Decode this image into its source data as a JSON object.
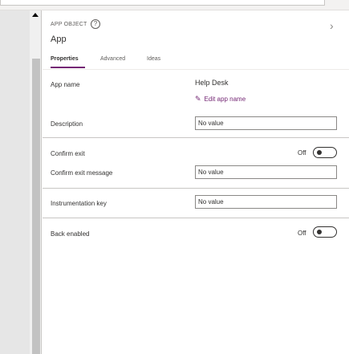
{
  "panel": {
    "object_type": "APP OBJECT",
    "object_name": "App",
    "info_icon": "?",
    "chevron_icon": "›"
  },
  "tabs": [
    {
      "label": "Properties",
      "active": true
    },
    {
      "label": "Advanced",
      "active": false
    },
    {
      "label": "Ideas",
      "active": false
    }
  ],
  "properties": {
    "app_name_label": "App name",
    "app_name_value": "Help Desk",
    "edit_app_name_label": "Edit app name",
    "description_label": "Description",
    "description_value": "No value",
    "confirm_exit_label": "Confirm exit",
    "confirm_exit_state": "Off",
    "confirm_exit_message_label": "Confirm exit message",
    "confirm_exit_message_value": "No value",
    "instrumentation_key_label": "Instrumentation key",
    "instrumentation_key_value": "No value",
    "back_enabled_label": "Back enabled",
    "back_enabled_state": "Off"
  },
  "icons": {
    "pencil": "pencil-icon",
    "info": "info-icon",
    "chevron": "chevron-right-icon",
    "scroll_up": "scroll-up-arrow-icon"
  },
  "colors": {
    "accent": "#742774",
    "text": "#323130",
    "muted": "#605e5c",
    "divider": "#c8c6c4"
  }
}
